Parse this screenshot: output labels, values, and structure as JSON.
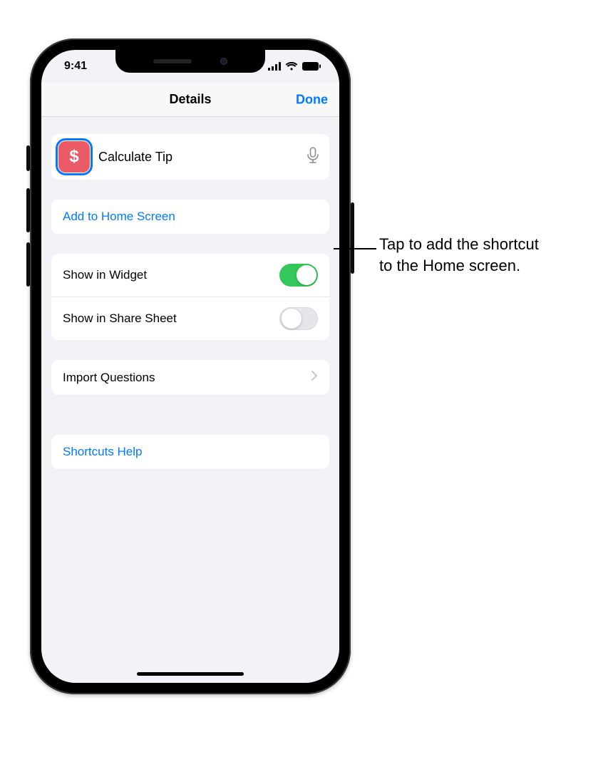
{
  "status": {
    "time": "9:41"
  },
  "nav": {
    "title": "Details",
    "done": "Done"
  },
  "shortcut": {
    "name": "Calculate Tip",
    "glyph": "$"
  },
  "rows": {
    "add_home": "Add to Home Screen",
    "show_widget": "Show in Widget",
    "show_share": "Show in Share Sheet",
    "import_questions": "Import Questions",
    "help": "Shortcuts Help"
  },
  "toggles": {
    "show_widget_on": true,
    "show_share_on": false
  },
  "callout": {
    "line1": "Tap to add the shortcut",
    "line2": "to the Home screen."
  },
  "colors": {
    "tint": "#007aff",
    "shortcut_icon_bg": "#ea5b67",
    "toggle_on": "#34c759"
  }
}
